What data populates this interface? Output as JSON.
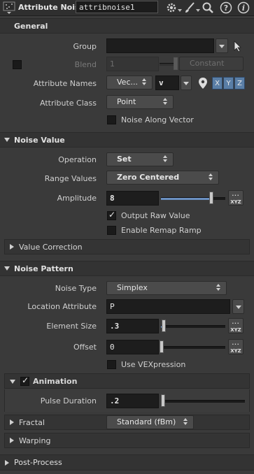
{
  "header": {
    "node_type": "Attribute Noise",
    "node_name": "attribnoise1",
    "icons": [
      "gear-icon",
      "brush-icon",
      "search-icon",
      "help-icon",
      "info-icon"
    ]
  },
  "general": {
    "title": "General",
    "group_label": "Group",
    "group_value": "",
    "blend_label": "Blend",
    "blend_value": "1",
    "blend_mode": "Constant",
    "attribute_names_label": "Attribute Names",
    "attribute_type": "Vec...",
    "attribute_name_value": "v",
    "components": [
      "X",
      "Y",
      "Z"
    ],
    "attribute_class_label": "Attribute Class",
    "attribute_class_value": "Point",
    "noise_along_vector_label": "Noise Along Vector"
  },
  "noise_value": {
    "title": "Noise Value",
    "operation_label": "Operation",
    "operation_value": "Set",
    "range_values_label": "Range Values",
    "range_values_value": "Zero Centered",
    "amplitude_label": "Amplitude",
    "amplitude_value": "8",
    "output_raw_value_label": "Output Raw Value",
    "output_raw_value_checked": true,
    "enable_remap_ramp_label": "Enable Remap Ramp",
    "value_correction_label": "Value Correction"
  },
  "noise_pattern": {
    "title": "Noise Pattern",
    "noise_type_label": "Noise Type",
    "noise_type_value": "Simplex",
    "location_attribute_label": "Location Attribute",
    "location_attribute_value": "P",
    "element_size_label": "Element Size",
    "element_size_value": ".3",
    "offset_label": "Offset",
    "offset_value": "0",
    "use_vexpression_label": "Use VEXpression",
    "animation_label": "Animation",
    "animation_checked": true,
    "pulse_duration_label": "Pulse Duration",
    "pulse_duration_value": ".2",
    "fractal_label": "Fractal",
    "fractal_value": "Standard (fBm)",
    "warping_label": "Warping"
  },
  "post_process": {
    "title": "Post-Process"
  },
  "xyz_button_label": "XYZ",
  "accent_color": "#5a7ea6"
}
